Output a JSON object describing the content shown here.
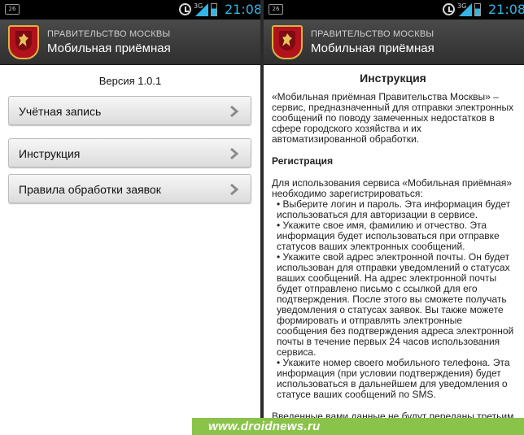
{
  "status": {
    "notification": "26",
    "network": "3G",
    "time": "21:08",
    "accent": "#33b5e5"
  },
  "app": {
    "subtitle": "ПРАВИТЕЛЬСТВО МОСКВЫ",
    "title": "Мобильная приёмная",
    "emblem_icon": "moscow-coat-of-arms"
  },
  "main": {
    "version": "Версия 1.0.1",
    "menu": [
      {
        "label": "Учётная запись",
        "icon": "chevron-right-icon"
      },
      {
        "label": "Инструкция",
        "icon": "chevron-right-icon"
      },
      {
        "label": "Правила обработки заявок",
        "icon": "chevron-right-icon"
      }
    ]
  },
  "instruction": {
    "title": "Инструкция",
    "intro": "«Мобильная приёмная Правительства Москвы» – сервис, предназначенный для отправки электронных сообщений по поводу замеченных недостатков в сфере городского хозяйства и их автоматизированной обработки.",
    "section_heading": "Регистрация",
    "lead": "Для использования сервиса «Мобильная приёмная» необходимо зарегистрироваться:",
    "items": [
      "• Выберите логин и пароль. Эта информация будет использоваться для авторизации в сервисе.",
      "• Укажите свое имя, фамилию и отчество. Эта информация будет использоваться при отправке статусов ваших электронных сообщений.",
      "• Укажите свой адрес электронной почты. Он будет использован для отправки уведомлений о статусах ваших сообщений. На адрес электронной почты будет отправлено письмо с ссылкой для его подтверждения. После этого вы сможете получать уведомления о статусах заявок. Вы также можете формировать и отправлять электронные сообщения без подтверждения адреса электронной почты в течение первых 24 часов использования сервиса.",
      "• Укажите номер своего мобильного телефона. Эта информация (при условии подтверждения) будет использоваться в дальнейшем для уведомления о статусе ваших сообщений по SMS."
    ],
    "footer": "Введенные вами данные не будут переданы третьим лицам и будут использоваться исключительно с"
  },
  "watermark": {
    "text": "www.droidnews.ru",
    "color": "#8ac34a"
  }
}
